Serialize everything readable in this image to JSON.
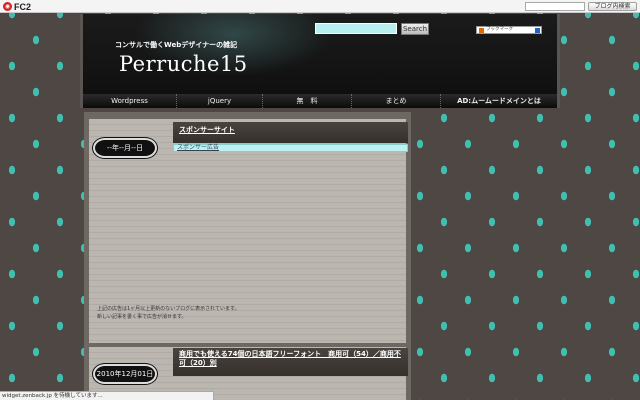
{
  "fc2bar": {
    "logo_text": "FC2",
    "search_placeholder": "",
    "search_button": "ブログ内検索"
  },
  "header": {
    "tagline": "コンサルで働くWebデザイナーの雑記",
    "title": "Perruche15",
    "search_button": "Search",
    "bookmark_badge": "ブックマーク"
  },
  "nav": {
    "items": [
      {
        "label": "Wordpress"
      },
      {
        "label": "jQuery"
      },
      {
        "label": "無　料"
      },
      {
        "label": "まとめ"
      },
      {
        "label": "AD:ムームードメインとは"
      }
    ]
  },
  "posts": [
    {
      "date": "--年--月--日",
      "title": "スポンサーサイト",
      "ad_link": "スポンサー広告",
      "note_line1": "上記の広告は1ヶ月以上更新のないブログに表示されています。",
      "note_line2": "新しい記事を書く事で広告が消せます。"
    },
    {
      "date": "2010年12月01日",
      "title": "商用でも使える74個の日本語フリーフォント　商用可（54）／商用不可（20）別"
    }
  ],
  "statusbar": {
    "text": "widget.zenback.jp を待機しています..."
  },
  "colors": {
    "background": "#4e4743",
    "pattern": "#3fbfb0",
    "header_bg": "#141414",
    "search_input": "#b8eeee",
    "post_bg": "#bcb6b1",
    "entry_title_bg": "#4a4440"
  }
}
